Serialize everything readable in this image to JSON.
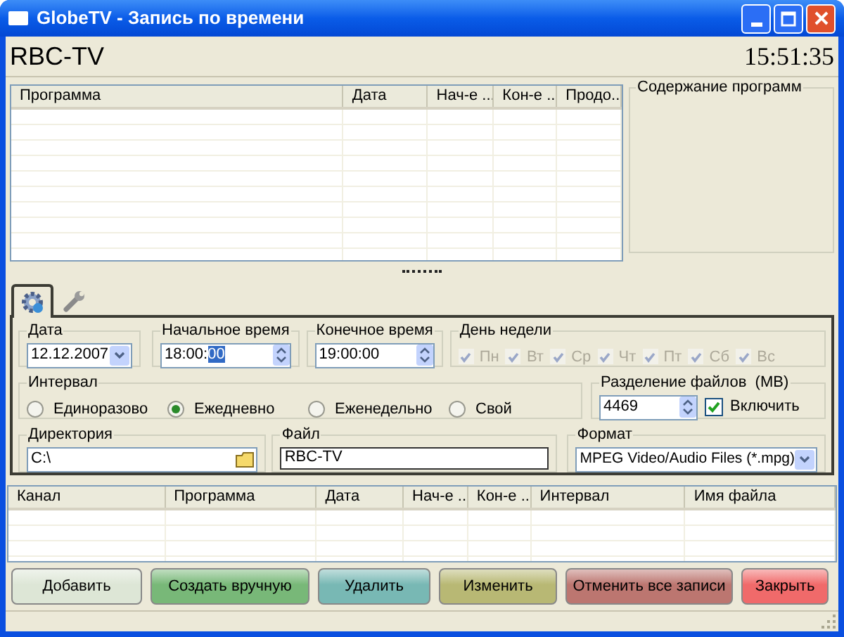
{
  "window": {
    "title": "GlobeTV - Запись по времени"
  },
  "header": {
    "channel": "RBC-TV",
    "clock": "15:51:35"
  },
  "program_table": {
    "columns": [
      "Программа",
      "Дата",
      "Нач-е ...",
      "Кон-е ...",
      "Продо..."
    ]
  },
  "content_panel": {
    "title": "Содержание программ"
  },
  "tabs": [
    {
      "kind": "gear",
      "selected": true
    },
    {
      "kind": "wrench",
      "selected": false
    }
  ],
  "date": {
    "label": "Дата",
    "value": "12.12.2007"
  },
  "start_time": {
    "label": "Начальное время",
    "value": "18:00:",
    "selection": "00"
  },
  "end_time": {
    "label": "Конечное время",
    "value": "19:00:00"
  },
  "weekdays": {
    "label": "День недели",
    "days": [
      {
        "label": "Пн",
        "checked": true,
        "disabled": true
      },
      {
        "label": "Вт",
        "checked": true,
        "disabled": true
      },
      {
        "label": "Ср",
        "checked": true,
        "disabled": true
      },
      {
        "label": "Чт",
        "checked": true,
        "disabled": true
      },
      {
        "label": "Пт",
        "checked": true,
        "disabled": true
      },
      {
        "label": "Сб",
        "checked": true,
        "disabled": true
      },
      {
        "label": "Вс",
        "checked": true,
        "disabled": true
      }
    ]
  },
  "interval": {
    "label": "Интервал",
    "options": [
      {
        "label": "Единоразово",
        "selected": false
      },
      {
        "label": "Ежедневно",
        "selected": true
      },
      {
        "label": "Еженедельно",
        "selected": false
      },
      {
        "label": "Свой",
        "selected": false
      }
    ]
  },
  "split": {
    "label": "Разделение файлов  (MB)",
    "value": "4469",
    "enable_label": "Включить",
    "checked": true
  },
  "directory": {
    "label": "Директория",
    "value": "C:\\"
  },
  "file": {
    "label": "Файл",
    "value": "RBC-TV"
  },
  "format": {
    "label": "Формат",
    "value": "MPEG Video/Audio Files (*.mpg)"
  },
  "schedule_table": {
    "columns": [
      "Канал",
      "Программа",
      "Дата",
      "Нач-е ...",
      "Кон-е ...",
      "Интервал",
      "Имя файла"
    ]
  },
  "buttons": [
    {
      "label": "Добавить",
      "color": "#dde6d6"
    },
    {
      "label": "Создать вручную",
      "color": "#78b878"
    },
    {
      "label": "Удалить",
      "color": "#78b8b4"
    },
    {
      "label": "Изменить",
      "color": "#b8b874"
    },
    {
      "label": "Отменить все записи",
      "color": "#bc7670"
    },
    {
      "label": "Закрыть",
      "color": "#f06a6a"
    }
  ]
}
